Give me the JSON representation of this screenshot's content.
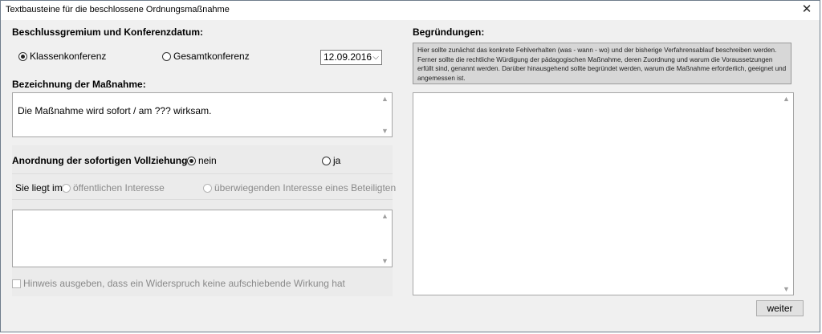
{
  "window": {
    "title": "Textbausteine für die beschlossene Ordnungsmaßnahme",
    "close_glyph": "✕"
  },
  "left": {
    "gremium_label": "Beschlussgremium und Konferenzdatum:",
    "radio_klassen": "Klassenkonferenz",
    "radio_gesamt": "Gesamtkonferenz",
    "date_value": "12.09.2016",
    "bezeichnung_label": "Bezeichnung der Maßnahme:",
    "bezeichnung_text": "Die Maßnahme wird sofort / am ??? wirksam.",
    "vollziehung_label": "Anordnung der sofortigen Vollziehung:",
    "radio_nein": "nein",
    "radio_ja": "ja",
    "liegt_label": "Sie liegt im",
    "radio_oeffentlich": "öffentlichen Interesse",
    "radio_ueberwiegend": "überwiegenden Interesse eines Beteiligten",
    "hinweis_label": "Hinweis ausgeben, dass ein Widerspruch keine aufschiebende Wirkung hat"
  },
  "right": {
    "begruendungen_label": "Begründungen:",
    "info_text": "Hier sollte zunächst das konkrete Fehlverhalten (was - wann - wo) und der bisherige Verfahrensablauf beschreiben werden. Ferner sollte die rechtliche Würdigung der pädagogischen Maßnahme, deren Zuordnung und warum die Voraussetzungen erfüllt sind, genannt werden. Darüber hinausgehend sollte begründet werden, warum die Maßnahme erforderlich, geeignet und angemessen ist.",
    "weiter_label": "weiter"
  },
  "icons": {
    "scroll_up": "▲",
    "scroll_down": "▼",
    "dropdown": "⌵"
  }
}
